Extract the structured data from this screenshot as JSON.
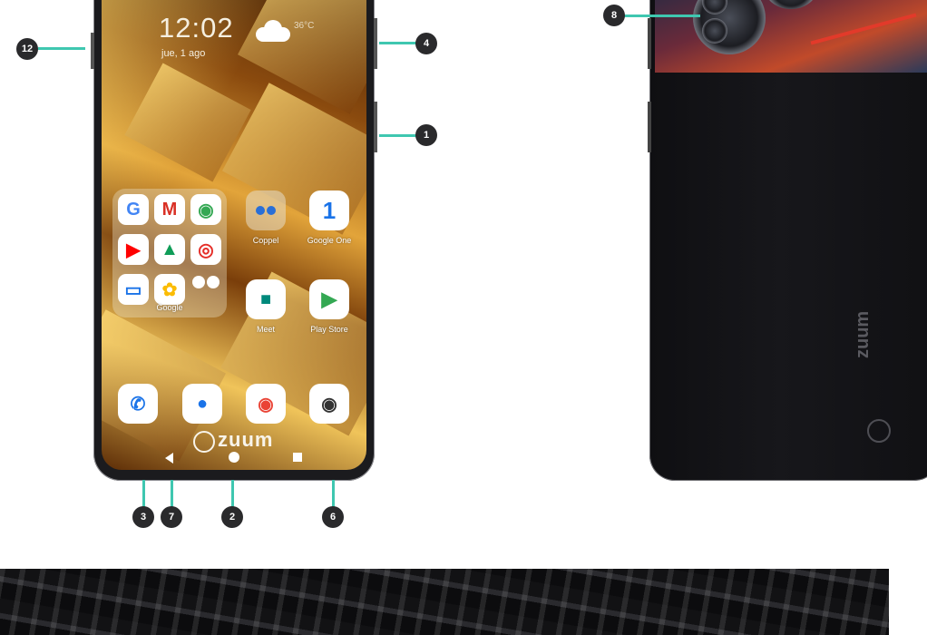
{
  "lockscreen": {
    "time": "12:02",
    "date": "jue, 1 ago",
    "temperature": "36°C"
  },
  "apps": {
    "folder_label": "Google",
    "coppel_label": "Coppel",
    "google_one_label": "Google One",
    "meet_label": "Meet",
    "play_store_label": "Play Store"
  },
  "brand": {
    "front_logo": "zuum",
    "back_logo": "zuum"
  },
  "callouts": [
    "12",
    "4",
    "1",
    "8",
    "3",
    "7",
    "2",
    "6"
  ],
  "colors": {
    "leader": "#3fc7b0",
    "callout": "#2a2a2c"
  }
}
